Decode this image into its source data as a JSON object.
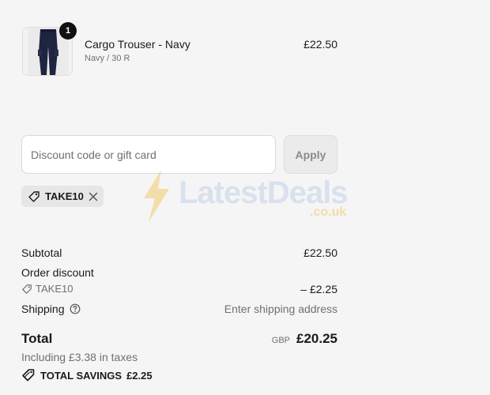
{
  "cart": {
    "items": [
      {
        "name": "Cargo Trouser - Navy",
        "variant": "Navy / 30 R",
        "price": "£22.50",
        "quantity": "1",
        "image_icon": "navy-trouser-image"
      }
    ]
  },
  "discount": {
    "placeholder": "Discount code or gift card",
    "apply_label": "Apply",
    "applied_code": "TAKE10",
    "tag_icon": "tag-icon",
    "remove_icon": "close-icon"
  },
  "watermark": {
    "text": "LatestDeals",
    "subtext": ".co.uk"
  },
  "summary": {
    "subtotal_label": "Subtotal",
    "subtotal_value": "£22.50",
    "order_discount_label": "Order discount",
    "order_discount_code": "TAKE10",
    "order_discount_value": "– £2.25",
    "shipping_label": "Shipping",
    "shipping_value": "Enter shipping address",
    "total_label": "Total",
    "total_currency": "GBP",
    "total_value": "£20.25",
    "taxes_note": "Including £3.38 in taxes",
    "savings_label": "TOTAL SAVINGS",
    "savings_value": "£2.25"
  },
  "colors": {
    "background": "#f5f5f5",
    "text": "#1a1a1a",
    "muted": "#707070",
    "badge": "#111111"
  }
}
